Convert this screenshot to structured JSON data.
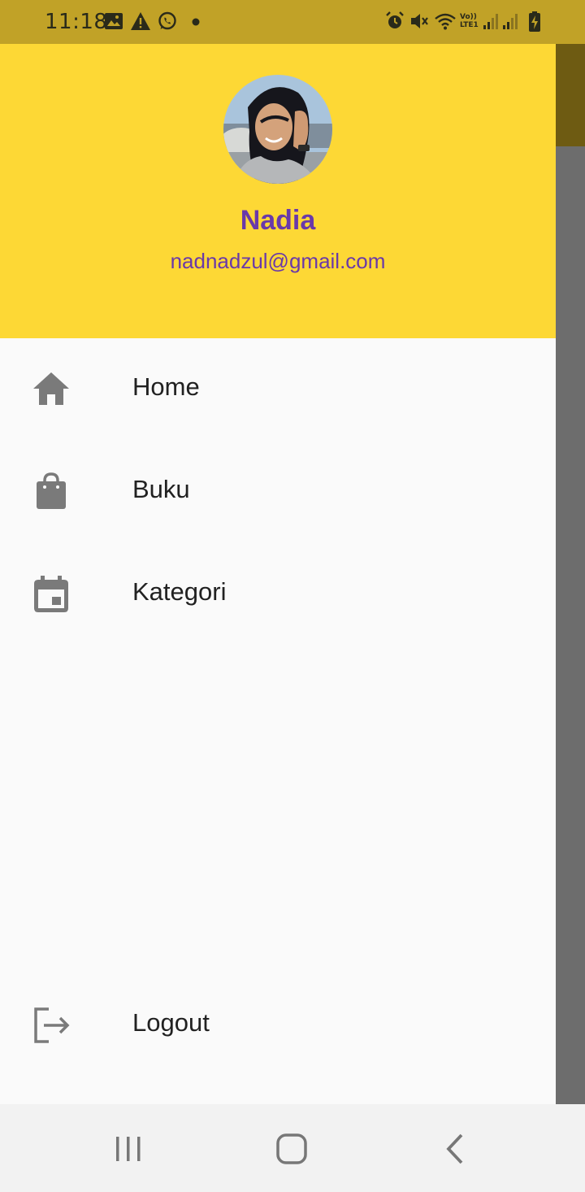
{
  "status_bar": {
    "time": "11:18",
    "left_icons": [
      "image-icon",
      "warning-icon",
      "whatsapp-icon",
      "dot-icon"
    ],
    "right_icons": [
      "alarm-icon",
      "mute-icon",
      "wifi-icon",
      "volte-icon",
      "signal-icon",
      "signal-icon-2",
      "battery-charging-icon"
    ],
    "volte_text": "Vo)) LTE1"
  },
  "drawer": {
    "header": {
      "name": "Nadia",
      "email": "nadnadzul@gmail.com",
      "colors": {
        "background": "#fdd835",
        "text": "#6a39a9"
      }
    },
    "items": [
      {
        "label": "Home",
        "icon": "home-icon"
      },
      {
        "label": "Buku",
        "icon": "shopping-bag-icon"
      },
      {
        "label": "Kategori",
        "icon": "calendar-icon"
      }
    ],
    "footer_item": {
      "label": "Logout",
      "icon": "logout-icon"
    }
  },
  "nav_bar": {
    "buttons": [
      "recent-apps-icon",
      "home-button-icon",
      "back-icon"
    ]
  }
}
